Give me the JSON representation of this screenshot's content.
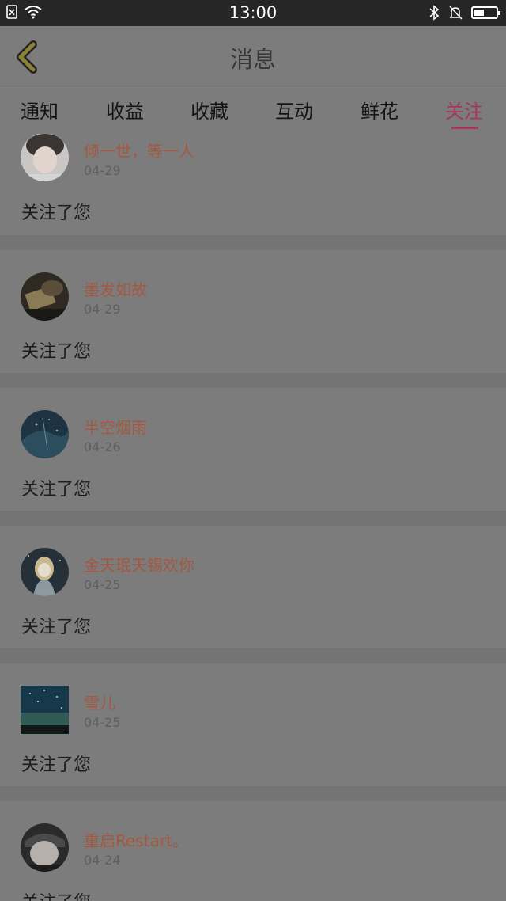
{
  "status_bar": {
    "time": "13:00",
    "battery_level": 0.45
  },
  "header": {
    "title": "消息",
    "back_icon": "chevron-left-icon"
  },
  "tabs": [
    {
      "label": "通知",
      "active": false
    },
    {
      "label": "收益",
      "active": false
    },
    {
      "label": "收藏",
      "active": false
    },
    {
      "label": "互动",
      "active": false
    },
    {
      "label": "鲜花",
      "active": false
    },
    {
      "label": "关注",
      "active": true
    }
  ],
  "colors": {
    "accent": "#a8355e",
    "username": "#a3583f",
    "background": "#7c7c7c",
    "status_bar": "#262626"
  },
  "notifications": [
    {
      "username": "倾一世，等一人",
      "date": "04-29",
      "message": "关注了您"
    },
    {
      "username": "墨发如故",
      "date": "04-29",
      "message": "关注了您"
    },
    {
      "username": "半空烟雨",
      "date": "04-26",
      "message": "关注了您"
    },
    {
      "username": "金天珉天锡欢你",
      "date": "04-25",
      "message": "关注了您"
    },
    {
      "username": "雪儿",
      "date": "04-25",
      "message": "关注了您"
    },
    {
      "username": "重启Restart。",
      "date": "04-24",
      "message": "关注了您"
    }
  ]
}
